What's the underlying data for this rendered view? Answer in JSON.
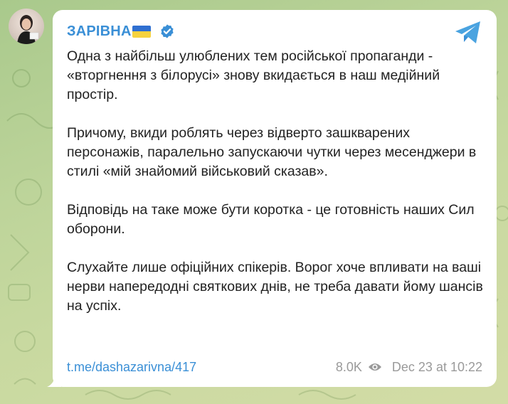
{
  "channel": {
    "name": "ЗАРІВНА",
    "flag_icon": "ukraine-flag-icon",
    "verified_icon": "verified-badge-icon",
    "share_icon": "telegram-share-icon",
    "colors": {
      "name": "#3a8fd6",
      "verified": "#3a8fd6",
      "share": "#4aa3e0",
      "flag_blue": "#2f6fd1",
      "flag_yellow": "#f7d23e"
    }
  },
  "post": {
    "paragraphs": [
      "Одна з найбільш улюблених тем російської пропаганди - «вторгнення з білорусі» знову вкидається в наш медійний простір.",
      "Причому, вкиди роблять через відверто зашкварених персонажів, паралельно запускаючи чутки через месенджери в стилі «мій знайомий військовий сказав».",
      "Відповідь на таке може бути коротка - це готовність наших Сил оборони.",
      "Слухайте лише офіційних спікерів. Ворог хоче впливати на ваші нерви напередодні святкових днів, не треба давати йому шансів на успіх."
    ],
    "link": "t.me/dashazarivna/417",
    "views": "8.0K",
    "views_icon": "eye-icon",
    "timestamp": "Dec 23 at 10:22"
  }
}
